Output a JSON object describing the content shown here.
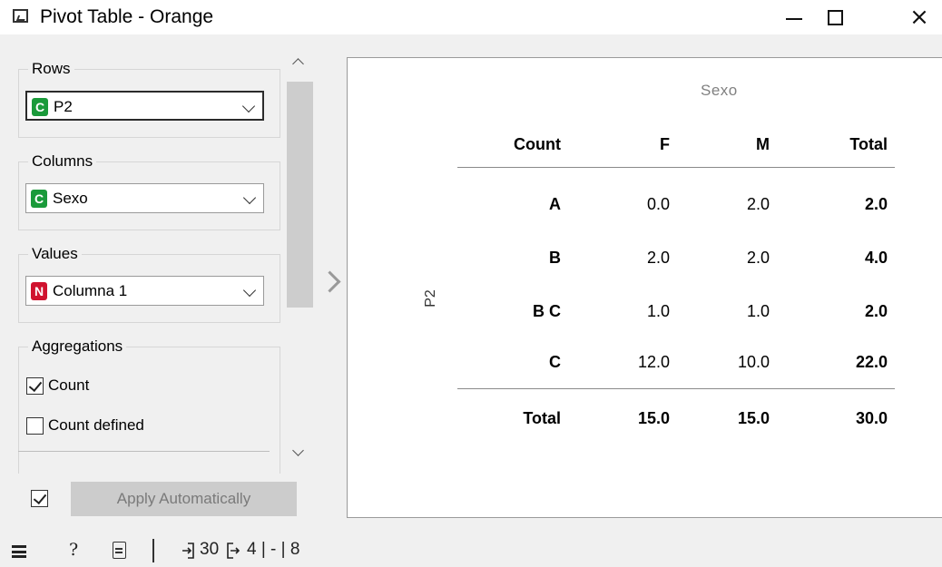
{
  "window": {
    "title": "Pivot Table - Orange",
    "controls": {
      "minimize_icon": "minimize-icon",
      "maximize_icon": "maximize-icon",
      "close_glyph": "×"
    }
  },
  "left_panel": {
    "rows": {
      "title": "Rows",
      "type_badge": "C",
      "badge_color": "#1a9a3a",
      "value": "P2"
    },
    "columns": {
      "title": "Columns",
      "type_badge": "C",
      "badge_color": "#1a9a3a",
      "value": "Sexo"
    },
    "values": {
      "title": "Values",
      "type_badge": "N",
      "badge_color": "#d0122e",
      "value": "Columna 1"
    },
    "aggregations": {
      "title": "Aggregations",
      "items": [
        {
          "label": "Count",
          "checked": true
        },
        {
          "label": "Count defined",
          "checked": false
        }
      ]
    },
    "apply": {
      "checked": true,
      "label": "Apply Automatically"
    }
  },
  "pivot": {
    "column_variable": "Sexo",
    "row_variable": "P2",
    "header": {
      "corner": "Count",
      "cols": [
        "F",
        "M",
        "Total"
      ]
    },
    "rows": [
      {
        "label": "A",
        "values": [
          "0.0",
          "2.0",
          "2.0"
        ]
      },
      {
        "label": "B",
        "values": [
          "2.0",
          "2.0",
          "4.0"
        ]
      },
      {
        "label": "B C",
        "values": [
          "1.0",
          "1.0",
          "2.0"
        ]
      },
      {
        "label": "C",
        "values": [
          "12.0",
          "10.0",
          "22.0"
        ]
      }
    ],
    "total_row": {
      "label": "Total",
      "values": [
        "15.0",
        "15.0",
        "30.0"
      ]
    }
  },
  "statusbar": {
    "help_glyph": "?",
    "input_count": "30",
    "output_text": "4 | - | 8"
  }
}
